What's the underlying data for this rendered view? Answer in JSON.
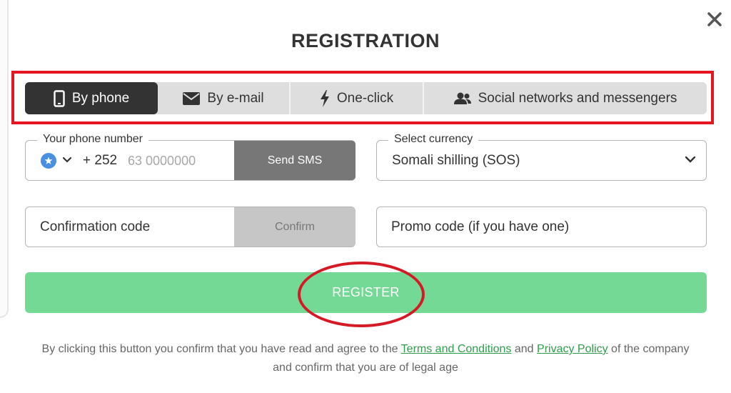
{
  "modal": {
    "title": "REGISTRATION",
    "close_icon": "close-icon"
  },
  "tabs": [
    {
      "label": "By phone",
      "icon": "phone-icon",
      "active": true
    },
    {
      "label": "By e-mail",
      "icon": "envelope-icon",
      "active": false
    },
    {
      "label": "One-click",
      "icon": "lightning-icon",
      "active": false
    },
    {
      "label": "Social networks and messengers",
      "icon": "users-icon",
      "active": false
    }
  ],
  "phone": {
    "legend": "Your phone number",
    "country_icon": "somalia-flag-icon",
    "dial_code": "+ 252",
    "placeholder": "63 0000000",
    "value": "",
    "send_sms_label": "Send SMS"
  },
  "currency": {
    "legend": "Select currency",
    "selected": "Somali shilling (SOS)"
  },
  "confirmation": {
    "placeholder": "Confirmation code",
    "confirm_label": "Confirm"
  },
  "promo": {
    "placeholder": "Promo code (if you have one)"
  },
  "register": {
    "label": "REGISTER"
  },
  "terms": {
    "before": "By clicking this button you confirm that you have read and agree to the ",
    "terms_link": "Terms and Conditions",
    "and": " and ",
    "privacy_link": "Privacy Policy",
    "after": " of the company and confirm that you are of legal age"
  },
  "colors": {
    "active_tab_bg": "#333333",
    "tab_bg": "#dedede",
    "register_bg": "#74d994",
    "send_sms_bg": "#777777",
    "confirm_bg": "#c6c6c6",
    "link": "#2e9d4b",
    "annotation_red": "#e5161f"
  }
}
